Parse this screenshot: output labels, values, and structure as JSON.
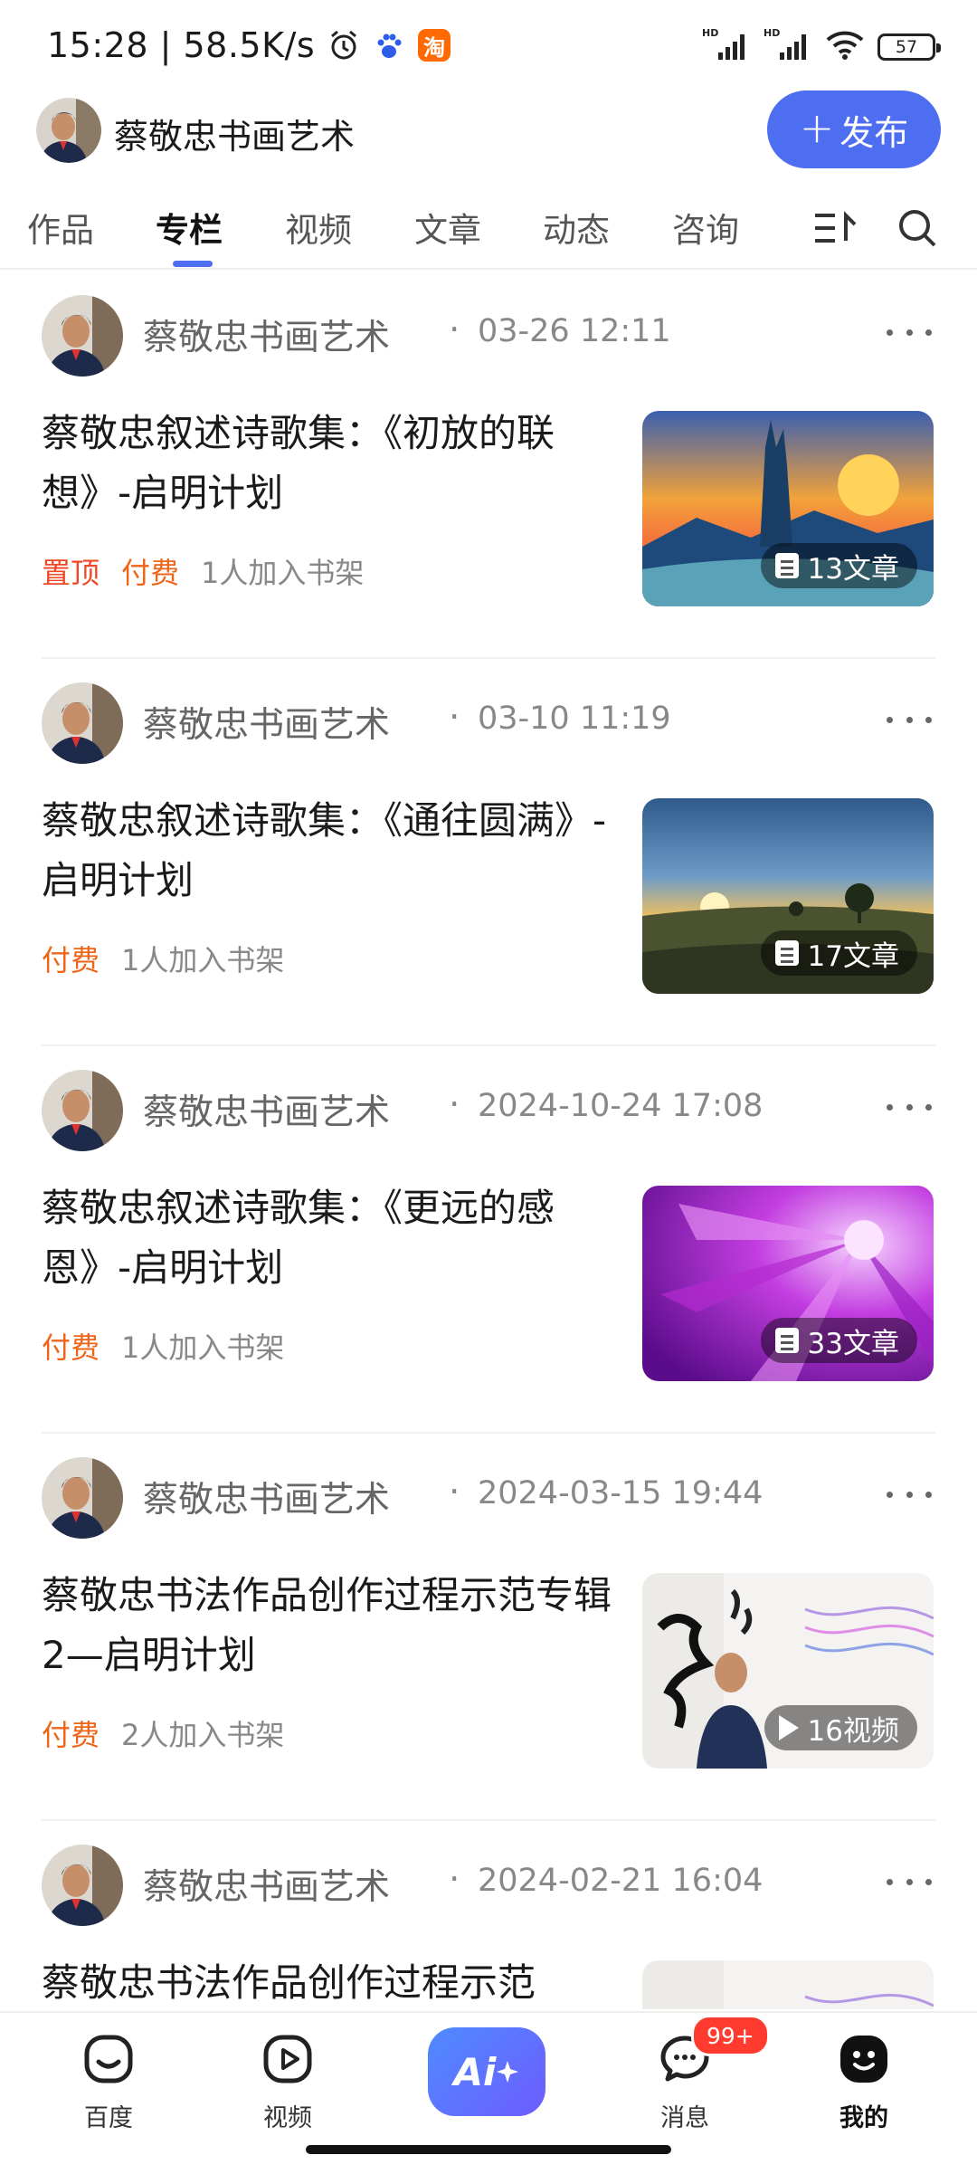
{
  "status_bar": {
    "time": "15:28",
    "net_speed": "58.5K/s",
    "taobao_glyph": "淘",
    "signal1_label": "HD",
    "signal2_label": "HD",
    "battery": "57",
    "icons": [
      "alarm-icon",
      "baidu-paw-icon",
      "taobao-icon",
      "signal-icon",
      "wifi-icon",
      "battery-icon"
    ]
  },
  "header": {
    "title": "蔡敬忠书画艺术",
    "publish_label": "发布",
    "publish_plus": "+",
    "accent_color": "#4e6ef2"
  },
  "tabs": [
    {
      "label": "作品"
    },
    {
      "label": "专栏",
      "active": true
    },
    {
      "label": "视频"
    },
    {
      "label": "文章"
    },
    {
      "label": "动态"
    },
    {
      "label": "咨询"
    }
  ],
  "feed": [
    {
      "author": "蔡敬忠书画艺术",
      "dot": "·",
      "time": "03-26 12:11",
      "title": "蔡敬忠叙述诗歌集：《初放的联想》-启明计划",
      "tags": [
        {
          "text": "置顶",
          "type": "pin"
        },
        {
          "text": "付费",
          "type": "paid"
        }
      ],
      "shelf": "1人加入书架",
      "badge": "13文章",
      "badge_icon": "document-icon",
      "thumb": "fantasy-spire-sunset"
    },
    {
      "author": "蔡敬忠书画艺术",
      "dot": "·",
      "time": "03-10 11:19",
      "title": "蔡敬忠叙述诗歌集：《通往圆满》-启明计划",
      "tags": [
        {
          "text": "付费",
          "type": "paid"
        }
      ],
      "shelf": "1人加入书架",
      "badge": "17文章",
      "badge_icon": "document-icon",
      "thumb": "meadow-sunrise"
    },
    {
      "author": "蔡敬忠书画艺术",
      "dot": "·",
      "time": "2024-10-24 17:08",
      "title": "蔡敬忠叙述诗歌集：《更远的感恩》-启明计划",
      "tags": [
        {
          "text": "付费",
          "type": "paid"
        }
      ],
      "shelf": "1人加入书架",
      "badge": "33文章",
      "badge_icon": "document-icon",
      "thumb": "purple-flower"
    },
    {
      "author": "蔡敬忠书画艺术",
      "dot": "·",
      "time": "2024-03-15 19:44",
      "title": "蔡敬忠书法作品创作过程示范专辑2—启明计划",
      "tags": [
        {
          "text": "付费",
          "type": "paid"
        }
      ],
      "shelf": "2人加入书架",
      "badge": "16视频",
      "badge_icon": "play-icon",
      "thumb": "calligraphy-video"
    },
    {
      "author": "蔡敬忠书画艺术",
      "dot": "·",
      "time": "2024-02-21 16:04",
      "title": "蔡敬忠书法作品创作过程示范",
      "tags": [],
      "shelf": "",
      "badge": "",
      "thumb": "calligraphy-video"
    }
  ],
  "bottom_nav": [
    {
      "label": "百度",
      "icon": "baidu-home-icon"
    },
    {
      "label": "视频",
      "icon": "video-play-icon"
    },
    {
      "label": "Ai",
      "icon": "ai-assistant-icon"
    },
    {
      "label": "消息",
      "icon": "message-icon",
      "badge": "99+"
    },
    {
      "label": "我的",
      "icon": "profile-face-icon",
      "active": true
    }
  ]
}
